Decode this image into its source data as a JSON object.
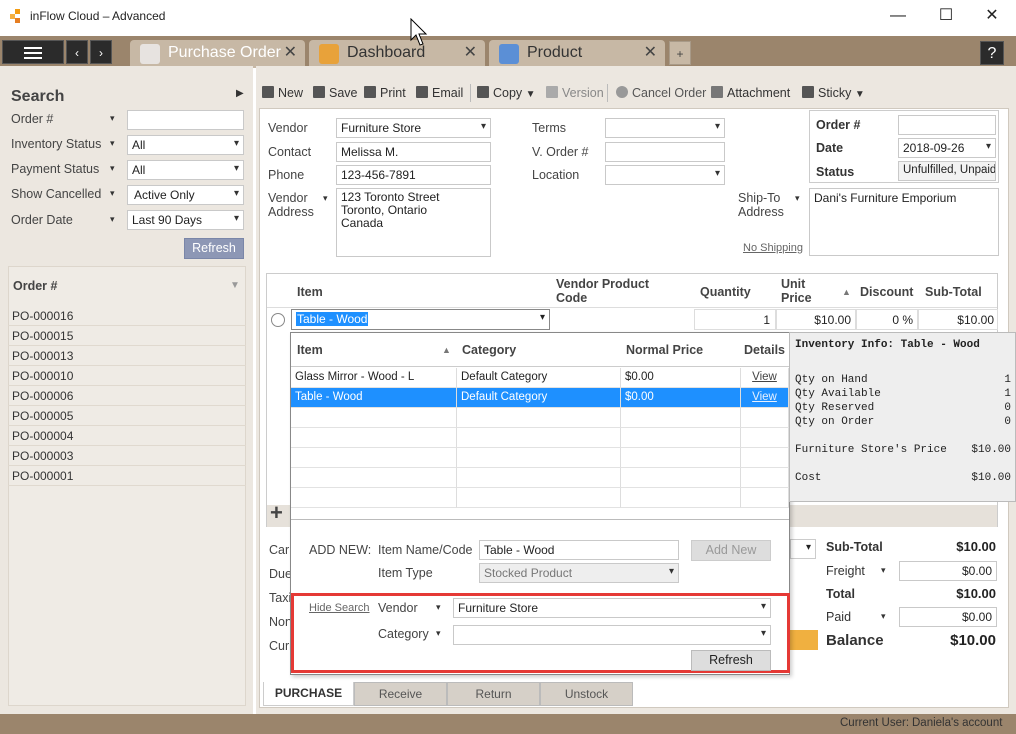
{
  "app": {
    "title": "inFlow Cloud – Advanced",
    "help": "?"
  },
  "window": {
    "minimize": "—",
    "maximize": "☐",
    "close": "✕"
  },
  "tabs": [
    {
      "label": "Purchase Order",
      "close": "✕"
    },
    {
      "label": "Dashboard",
      "close": "✕"
    },
    {
      "label": "Product",
      "close": "✕"
    }
  ],
  "tab_add": "+",
  "sidebar": {
    "heading": "Search",
    "filters": [
      {
        "label": "Order #",
        "value": ""
      },
      {
        "label": "Inventory Status",
        "value": "All"
      },
      {
        "label": "Payment Status",
        "value": "All"
      },
      {
        "label": "Show Cancelled",
        "value": "Active Only"
      },
      {
        "label": "Order Date",
        "value": "Last 90 Days"
      }
    ],
    "refresh": "Refresh",
    "list_header": "Order #",
    "orders": [
      "PO-000016",
      "PO-000015",
      "PO-000013",
      "PO-000010",
      "PO-000006",
      "PO-000005",
      "PO-000004",
      "PO-000003",
      "PO-000001"
    ]
  },
  "toolbar": {
    "new": "New",
    "save": "Save",
    "print": "Print",
    "email": "Email",
    "copy": "Copy",
    "version": "Version",
    "cancel_order": "Cancel Order",
    "attachment": "Attachment",
    "sticky": "Sticky"
  },
  "form": {
    "vendor_label": "Vendor",
    "vendor": "Furniture Store",
    "contact_label": "Contact",
    "contact": "Melissa M.",
    "phone_label": "Phone",
    "phone": "123-456-7891",
    "vendor_address_label1": "Vendor",
    "vendor_address_label2": "Address",
    "vendor_address": [
      "123 Toronto Street",
      "Toronto, Ontario",
      "Canada"
    ],
    "terms_label": "Terms",
    "terms": "",
    "vorder_label": "V. Order #",
    "vorder": "",
    "location_label": "Location",
    "location": "",
    "shipto_label1": "Ship-To",
    "shipto_label2": "Address",
    "shipto": "Dani's Furniture Emporium",
    "no_shipping": "No Shipping",
    "order_no_label": "Order #",
    "order_no": "",
    "date_label": "Date",
    "date": "2018-09-26",
    "status_label": "Status",
    "status": "Unfulfilled, Unpaid"
  },
  "grid": {
    "headers": {
      "item": "Item",
      "vendor_code": "Vendor Product Code",
      "quantity": "Quantity",
      "unit_price": "Unit Price",
      "discount": "Discount",
      "subtotal": "Sub-Total"
    },
    "row": {
      "item": "Table - Wood",
      "code": "",
      "quantity": "1",
      "unit_price": "$10.00",
      "discount": "0 %",
      "subtotal": "$10.00"
    },
    "add": "+"
  },
  "popup": {
    "headers": {
      "item": "Item",
      "category": "Category",
      "normal_price": "Normal Price",
      "details": "Details"
    },
    "rows": [
      {
        "item": "Glass Mirror - Wood - L",
        "category": "Default Category",
        "price": "$0.00",
        "details": "View"
      },
      {
        "item": "Table - Wood",
        "category": "Default Category",
        "price": "$0.00",
        "details": "View"
      }
    ],
    "add_new_label": "ADD NEW:",
    "item_name_label": "Item Name/Code",
    "item_name": "Table - Wood",
    "add_new_btn": "Add New",
    "item_type_label": "Item Type",
    "item_type": "Stocked Product",
    "hide_search": "Hide Search",
    "vendor_label": "Vendor",
    "vendor": "Furniture Store",
    "category_label": "Category",
    "category": "",
    "refresh": "Refresh"
  },
  "info": {
    "title": "Inventory Info: Table - Wood",
    "rows": [
      {
        "k": "Qty on Hand",
        "v": "1"
      },
      {
        "k": "Qty Available",
        "v": "1"
      },
      {
        "k": "Qty Reserved",
        "v": "0"
      },
      {
        "k": "Qty on Order",
        "v": "0"
      }
    ],
    "vendor_price_label": "Furniture Store's Price",
    "vendor_price": "$10.00",
    "cost_label": "Cost",
    "cost": "$10.00"
  },
  "totals": {
    "subtotal_label": "Sub-Total",
    "subtotal": "$10.00",
    "freight_label": "Freight",
    "freight": "$0.00",
    "total_label": "Total",
    "total": "$10.00",
    "paid_label": "Paid",
    "paid": "$0.00",
    "balance_label": "Balance",
    "balance": "$10.00"
  },
  "left_labels": [
    "Car",
    "Due",
    "Taxi",
    "Non",
    "Curi"
  ],
  "bottom_tabs": [
    "PURCHASE",
    "Receive",
    "Return",
    "Unstock"
  ],
  "statusbar": {
    "user_label": "Current User:",
    "user": "Daniela's account"
  },
  "colors": {
    "accent": "#9b856c",
    "sidebar": "#ece7e0",
    "selection": "#1e90ff",
    "highlight_box": "#e53935"
  }
}
